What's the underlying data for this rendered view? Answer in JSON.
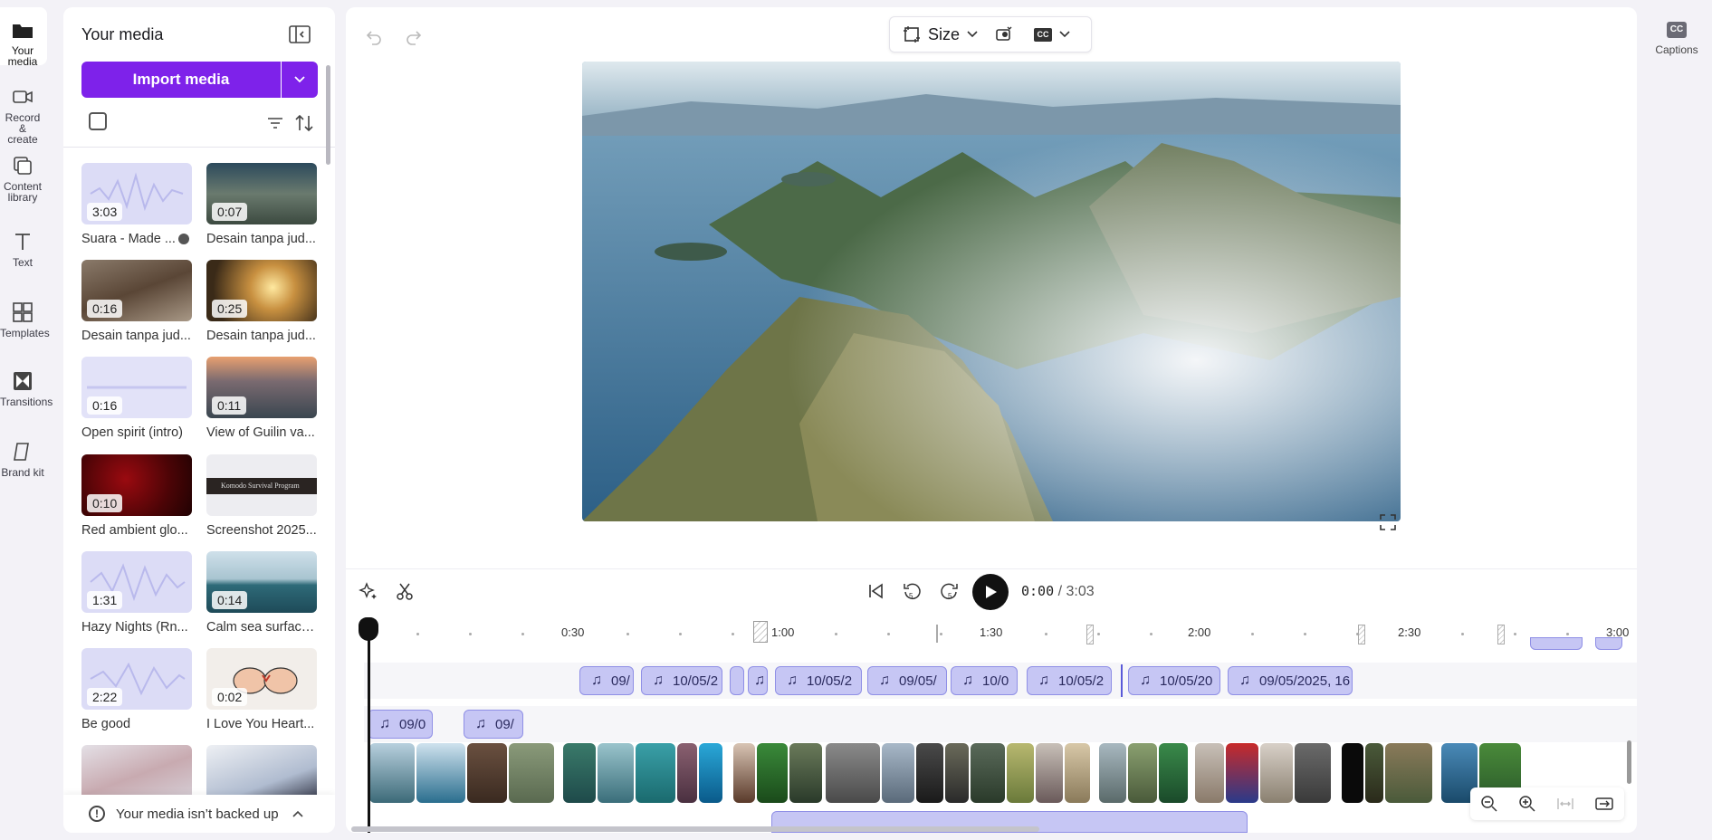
{
  "nav": {
    "items": [
      {
        "label": "Your media",
        "icon": "folder-icon"
      },
      {
        "label": "Record &\ncreate",
        "icon": "camera-icon"
      },
      {
        "label": "Content\nlibrary",
        "icon": "library-icon"
      },
      {
        "label": "Text",
        "icon": "text-icon"
      },
      {
        "label": "Templates",
        "icon": "templates-icon"
      },
      {
        "label": "Transitions",
        "icon": "transitions-icon"
      },
      {
        "label": "Brand kit",
        "icon": "brand-kit-icon"
      }
    ]
  },
  "media": {
    "title": "Your media",
    "import_label": "Import media",
    "backup_text": "Your media isn’t backed up",
    "tiles": [
      {
        "duration": "3:03",
        "name": "Suara - Made ...",
        "kind": "audio"
      },
      {
        "duration": "0:07",
        "name": "Desain tanpa jud...",
        "kind": "video"
      },
      {
        "duration": "0:16",
        "name": "Desain tanpa jud...",
        "kind": "video"
      },
      {
        "duration": "0:25",
        "name": "Desain tanpa jud...",
        "kind": "video"
      },
      {
        "duration": "0:16",
        "name": "Open spirit (intro)",
        "kind": "audio"
      },
      {
        "duration": "0:11",
        "name": "View of Guilin va...",
        "kind": "video"
      },
      {
        "duration": "0:10",
        "name": "Red ambient glo...",
        "kind": "video"
      },
      {
        "duration": "",
        "name": "Screenshot 2025...",
        "kind": "image",
        "thumb_text": "Komodo Survival Program"
      },
      {
        "duration": "1:31",
        "name": "Hazy Nights (Rn...",
        "kind": "audio"
      },
      {
        "duration": "0:14",
        "name": "Calm sea surface...",
        "kind": "video"
      },
      {
        "duration": "2:22",
        "name": "Be good",
        "kind": "audio"
      },
      {
        "duration": "0:02",
        "name": "I Love You Heart...",
        "kind": "video"
      }
    ]
  },
  "editor": {
    "toolbar": {
      "size_label": "Size"
    },
    "timecode": {
      "current": "0:00",
      "total": "/ 3:03"
    },
    "ruler": [
      {
        "label": "0:30"
      },
      {
        "label": "1:00"
      },
      {
        "label": "1:30"
      },
      {
        "label": "2:00"
      },
      {
        "label": "2:30"
      },
      {
        "label": "3:00"
      }
    ],
    "audio_track_1": [
      {
        "label": "09/"
      },
      {
        "label": "10/05/2"
      },
      {
        "label": ""
      },
      {
        "label": ""
      },
      {
        "label": "10/05/2"
      },
      {
        "label": "09/05/"
      },
      {
        "label": "10/0"
      },
      {
        "label": "10/05/2"
      },
      {
        "label": "10/05/20"
      },
      {
        "label": "09/05/2025, 16"
      }
    ],
    "audio_track_2": [
      {
        "label": "09/0"
      },
      {
        "label": "09/"
      }
    ]
  },
  "right": {
    "captions_label": "Captions"
  },
  "colors": {
    "accent": "#7e22ea",
    "audio_clip": "#c6c6f4"
  }
}
